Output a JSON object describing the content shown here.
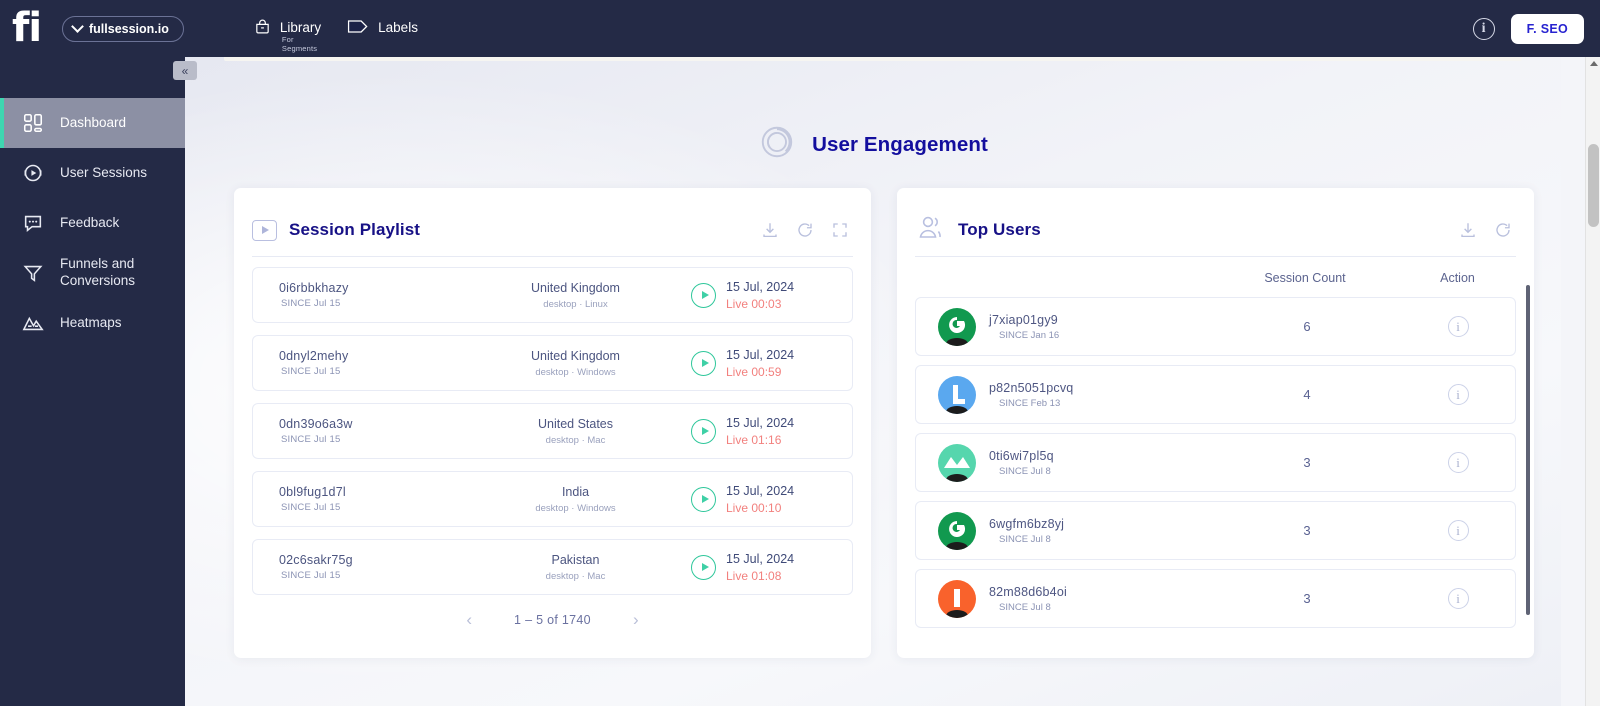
{
  "topbar": {
    "logo": "fi",
    "site_selector": {
      "label": "fullsession.io",
      "icon": "chevron-down-icon"
    },
    "nav": [
      {
        "label": "Library",
        "sublabel": "For Segments",
        "icon": "bag-icon"
      },
      {
        "label": "Labels",
        "sublabel": "",
        "icon": "tag-icon"
      }
    ],
    "info_icon": "info-icon",
    "account_button": "F. SEO"
  },
  "sidebar": {
    "collapse_label": "«",
    "items": [
      {
        "label": "Dashboard",
        "icon": "dashboard-grid-icon",
        "active": true
      },
      {
        "label": "User Sessions",
        "icon": "play-circle-icon",
        "active": false
      },
      {
        "label": "Feedback",
        "icon": "chat-bubble-icon",
        "active": false
      },
      {
        "label": "Funnels and Conversions",
        "icon": "funnel-icon",
        "active": false
      },
      {
        "label": "Heatmaps",
        "icon": "heatmap-mountain-icon",
        "active": false
      }
    ]
  },
  "page": {
    "title": "User Engagement",
    "title_icon": "swirl-ring-icon"
  },
  "session_playlist": {
    "title": "Session Playlist",
    "icon": "play-rect-icon",
    "actions": [
      "download-icon",
      "refresh-icon",
      "expand-icon"
    ],
    "rows": [
      {
        "id": "0i6rbbkhazy",
        "since": "SINCE Jul 15",
        "country": "United Kingdom",
        "device": "desktop · Linux",
        "date": "15 Jul, 2024",
        "live": "Live 00:03"
      },
      {
        "id": "0dnyl2mehy",
        "since": "SINCE Jul 15",
        "country": "United Kingdom",
        "device": "desktop · Windows",
        "date": "15 Jul, 2024",
        "live": "Live 00:59"
      },
      {
        "id": "0dn39o6a3w",
        "since": "SINCE Jul 15",
        "country": "United States",
        "device": "desktop · Mac",
        "date": "15 Jul, 2024",
        "live": "Live 01:16"
      },
      {
        "id": "0bl9fug1d7l",
        "since": "SINCE Jul 15",
        "country": "India",
        "device": "desktop · Windows",
        "date": "15 Jul, 2024",
        "live": "Live 00:10"
      },
      {
        "id": "02c6sakr75g",
        "since": "SINCE Jul 15",
        "country": "Pakistan",
        "device": "desktop · Mac",
        "date": "15 Jul, 2024",
        "live": "Live 01:08"
      }
    ],
    "pagination": {
      "prev": "‹",
      "label": "1 – 5 of 1740",
      "next": "›"
    }
  },
  "top_users": {
    "title": "Top Users",
    "icon": "users-icon",
    "actions": [
      "download-icon",
      "refresh-icon"
    ],
    "columns": {
      "user": "",
      "session_count": "Session Count",
      "action": "Action"
    },
    "rows": [
      {
        "id": "j7xiap01gy9",
        "since": "SINCE Jan 16",
        "count": "6",
        "avatar_color": "#11994f",
        "avatar_glyph": "swirl"
      },
      {
        "id": "p82n5051pcvq",
        "since": "SINCE Feb 13",
        "count": "4",
        "avatar_color": "#5aa8ef",
        "avatar_glyph": "l-shape"
      },
      {
        "id": "0ti6wi7pl5q",
        "since": "SINCE Jul 8",
        "count": "3",
        "avatar_color": "#56d6ad",
        "avatar_glyph": "mountains"
      },
      {
        "id": "6wgfm6bz8yj",
        "since": "SINCE Jul 8",
        "count": "3",
        "avatar_color": "#11994f",
        "avatar_glyph": "swirl"
      },
      {
        "id": "82m88d6b4oi",
        "since": "SINCE Jul 8",
        "count": "3",
        "avatar_color": "#f9622c",
        "avatar_glyph": "bar"
      }
    ]
  },
  "colors": {
    "topbar_bg": "#242a46",
    "sidebar_bg": "#242a46",
    "active_accent": "#3ed6b0",
    "title_blue": "#130e9e",
    "live_red": "#f2807e",
    "play_green": "#2fc79b"
  }
}
